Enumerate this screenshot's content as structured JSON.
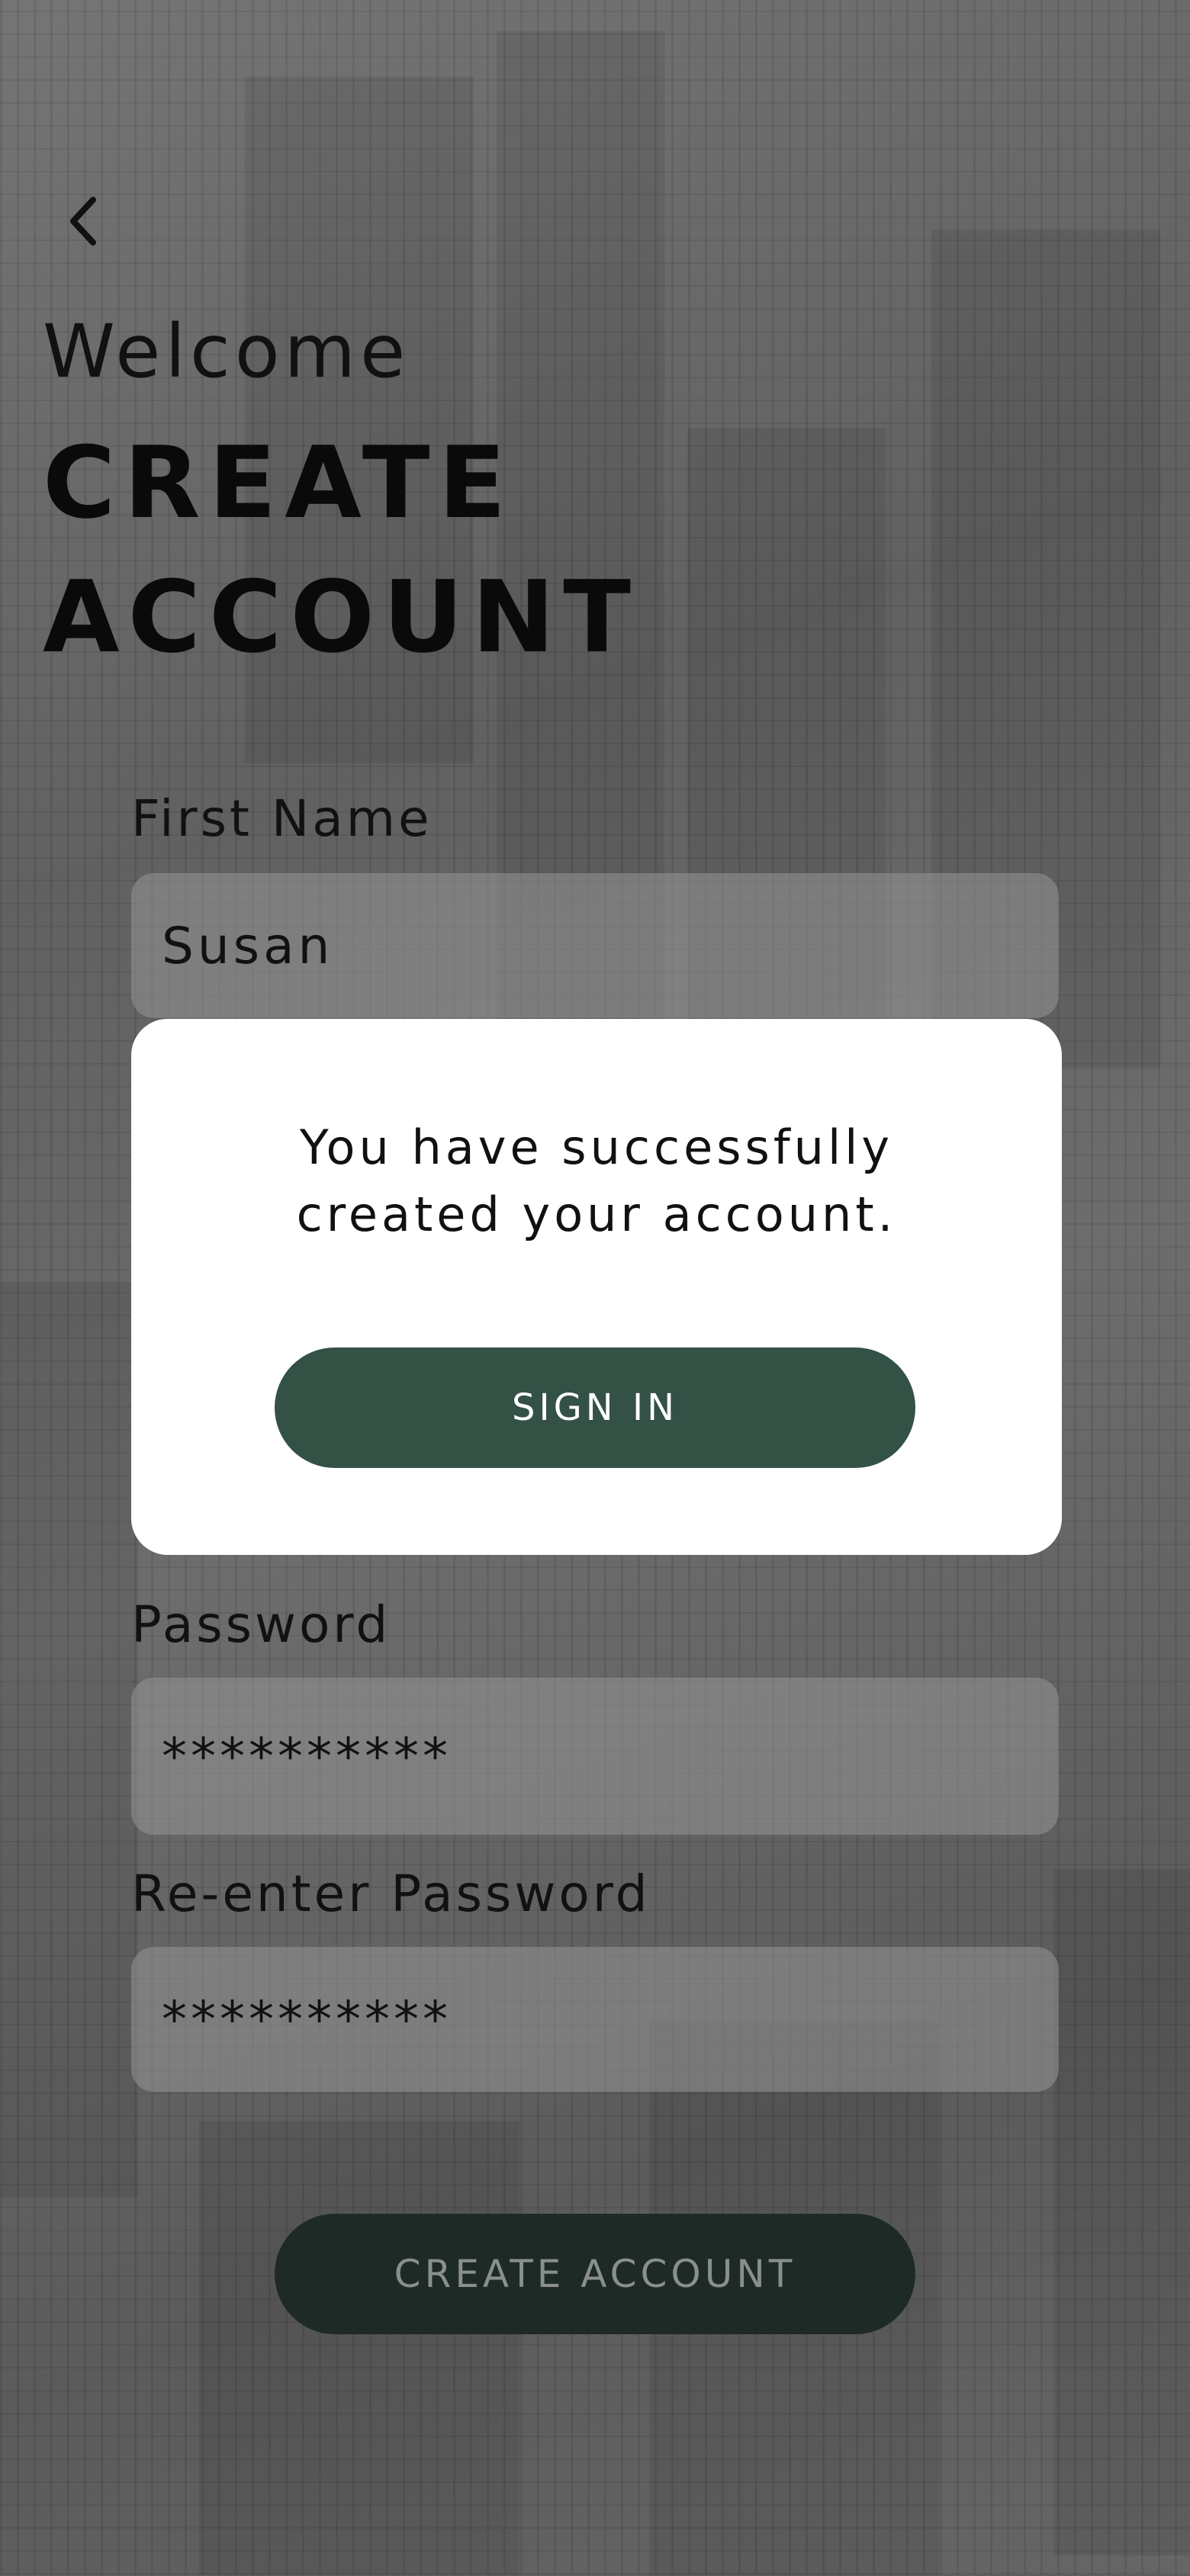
{
  "header": {
    "welcome": "Welcome",
    "title_line1": "CREATE",
    "title_line2": "ACCOUNT"
  },
  "form": {
    "first_name_label": "First Name",
    "first_name_value": "Susan",
    "password_label": "Password",
    "password_value": "**********",
    "reenter_label": "Re-enter Password",
    "reenter_value": "**********",
    "create_button": "CREATE ACCOUNT"
  },
  "modal": {
    "message_line1": "You have successfully",
    "message_line2": "created your account.",
    "sign_in_button": "SIGN IN"
  },
  "colors": {
    "primary": "#345146",
    "create_button_bg": "#1e2a25",
    "modal_bg": "#ffffff"
  },
  "icons": {
    "back": "chevron-left-icon"
  }
}
